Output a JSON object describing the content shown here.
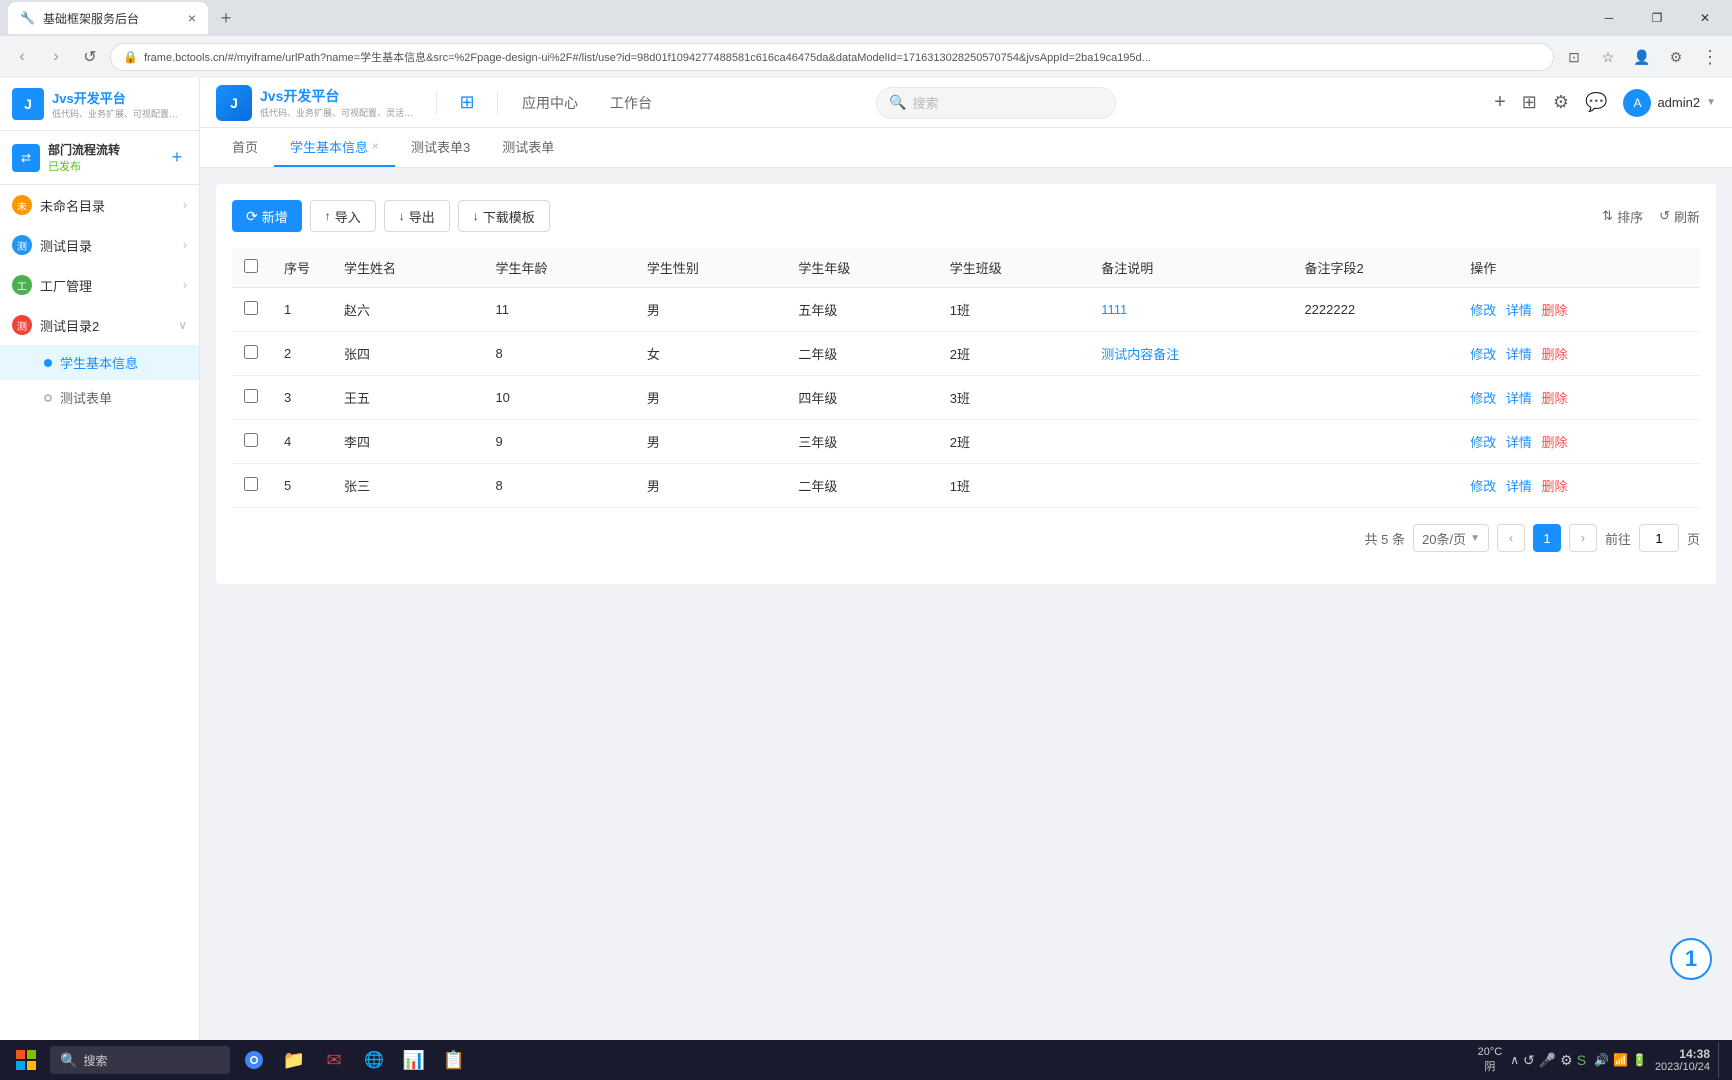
{
  "browser": {
    "tab_title": "基础框架服务后台",
    "address": "frame.bctools.cn/#/myiframe/urlPath?name=学生基本信息&src=%2Fpage-design-ui%2F#/list/use?id=98d01f1094277488581c616ca46475da&dataModelId=1716313028250570754&jvsAppId=2ba19ca195d...",
    "favicon": "🔧"
  },
  "top_nav": {
    "logo_title": "Jvs开发平台",
    "logo_subtitle": "低代码、业务扩展、可视配置、灵活定义",
    "app_center": "应用中心",
    "workbench": "工作台",
    "search_placeholder": "搜索",
    "user": "admin2",
    "add_icon": "+",
    "grid_icon": "⊞",
    "settings_icon": "⚙",
    "notification_icon": "💬"
  },
  "sidebar": {
    "title": "部门流程流转",
    "subtitle": "已发布",
    "items": [
      {
        "id": "unnamed",
        "label": "未命名目录",
        "color": "#ff9800",
        "has_children": true
      },
      {
        "id": "test-dir",
        "label": "测试目录",
        "color": "#2196f3",
        "has_children": true
      },
      {
        "id": "factory",
        "label": "工厂管理",
        "color": "#4caf50",
        "has_children": true
      },
      {
        "id": "test-dir2",
        "label": "测试目录2",
        "color": "#f44336",
        "has_children": true,
        "expanded": true
      }
    ],
    "sub_items": [
      {
        "id": "student-info",
        "label": "学生基本信息",
        "active": true
      },
      {
        "id": "test-form",
        "label": "测试表单",
        "active": false
      }
    ]
  },
  "tabs": [
    {
      "id": "home",
      "label": "首页",
      "closable": false
    },
    {
      "id": "student-info",
      "label": "学生基本信息",
      "closable": true,
      "active": true
    },
    {
      "id": "test-form3",
      "label": "测试表单3",
      "closable": false
    },
    {
      "id": "test-form",
      "label": "测试表单",
      "closable": false
    }
  ],
  "toolbar": {
    "new_btn": "新增",
    "import_btn": "导入",
    "export_btn": "导出",
    "download_template_btn": "下载模板",
    "sort_btn": "排序",
    "refresh_btn": "刷新"
  },
  "table": {
    "columns": [
      "序号",
      "学生姓名",
      "学生年龄",
      "学生性别",
      "学生年级",
      "学生班级",
      "备注说明",
      "备注字段2",
      "操作"
    ],
    "rows": [
      {
        "id": 1,
        "name": "赵六",
        "age": "11",
        "gender": "男",
        "grade": "五年级",
        "class": "1班",
        "remark": "1111",
        "remark2": "2222222",
        "actions": [
          "修改",
          "详情",
          "删除"
        ]
      },
      {
        "id": 2,
        "name": "张四",
        "age": "8",
        "gender": "女",
        "grade": "二年级",
        "class": "2班",
        "remark": "测试内容备注",
        "remark2": "",
        "actions": [
          "修改",
          "详情",
          "删除"
        ]
      },
      {
        "id": 3,
        "name": "王五",
        "age": "10",
        "gender": "男",
        "grade": "四年级",
        "class": "3班",
        "remark": "",
        "remark2": "",
        "actions": [
          "修改",
          "详情",
          "删除"
        ]
      },
      {
        "id": 4,
        "name": "李四",
        "age": "9",
        "gender": "男",
        "grade": "三年级",
        "class": "2班",
        "remark": "",
        "remark2": "",
        "actions": [
          "修改",
          "详情",
          "删除"
        ]
      },
      {
        "id": 5,
        "name": "张三",
        "age": "8",
        "gender": "男",
        "grade": "二年级",
        "class": "1班",
        "remark": "",
        "remark2": "",
        "actions": [
          "修改",
          "详情",
          "删除"
        ]
      }
    ],
    "action_edit": "修改",
    "action_detail": "详情",
    "action_delete": "删除"
  },
  "pagination": {
    "total_text": "共 5 条",
    "page_size": "20条/页",
    "current_page": 1,
    "goto_label": "前往",
    "page_label": "页"
  },
  "circle_badge": "1",
  "taskbar": {
    "search_placeholder": "搜索",
    "time": "14:38",
    "date": "2023/10/24",
    "temperature": "20°C",
    "weather": "阴"
  }
}
